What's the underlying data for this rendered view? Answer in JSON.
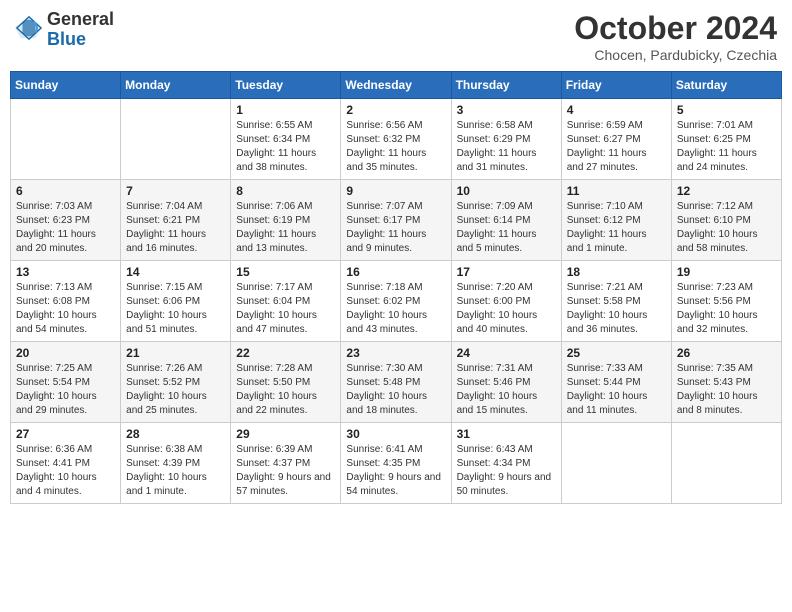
{
  "header": {
    "logo_general": "General",
    "logo_blue": "Blue",
    "month_title": "October 2024",
    "location": "Chocen, Pardubicky, Czechia"
  },
  "weekdays": [
    "Sunday",
    "Monday",
    "Tuesday",
    "Wednesday",
    "Thursday",
    "Friday",
    "Saturday"
  ],
  "weeks": [
    [
      {
        "day": null
      },
      {
        "day": null
      },
      {
        "day": "1",
        "sunrise": "Sunrise: 6:55 AM",
        "sunset": "Sunset: 6:34 PM",
        "daylight": "Daylight: 11 hours and 38 minutes."
      },
      {
        "day": "2",
        "sunrise": "Sunrise: 6:56 AM",
        "sunset": "Sunset: 6:32 PM",
        "daylight": "Daylight: 11 hours and 35 minutes."
      },
      {
        "day": "3",
        "sunrise": "Sunrise: 6:58 AM",
        "sunset": "Sunset: 6:29 PM",
        "daylight": "Daylight: 11 hours and 31 minutes."
      },
      {
        "day": "4",
        "sunrise": "Sunrise: 6:59 AM",
        "sunset": "Sunset: 6:27 PM",
        "daylight": "Daylight: 11 hours and 27 minutes."
      },
      {
        "day": "5",
        "sunrise": "Sunrise: 7:01 AM",
        "sunset": "Sunset: 6:25 PM",
        "daylight": "Daylight: 11 hours and 24 minutes."
      }
    ],
    [
      {
        "day": "6",
        "sunrise": "Sunrise: 7:03 AM",
        "sunset": "Sunset: 6:23 PM",
        "daylight": "Daylight: 11 hours and 20 minutes."
      },
      {
        "day": "7",
        "sunrise": "Sunrise: 7:04 AM",
        "sunset": "Sunset: 6:21 PM",
        "daylight": "Daylight: 11 hours and 16 minutes."
      },
      {
        "day": "8",
        "sunrise": "Sunrise: 7:06 AM",
        "sunset": "Sunset: 6:19 PM",
        "daylight": "Daylight: 11 hours and 13 minutes."
      },
      {
        "day": "9",
        "sunrise": "Sunrise: 7:07 AM",
        "sunset": "Sunset: 6:17 PM",
        "daylight": "Daylight: 11 hours and 9 minutes."
      },
      {
        "day": "10",
        "sunrise": "Sunrise: 7:09 AM",
        "sunset": "Sunset: 6:14 PM",
        "daylight": "Daylight: 11 hours and 5 minutes."
      },
      {
        "day": "11",
        "sunrise": "Sunrise: 7:10 AM",
        "sunset": "Sunset: 6:12 PM",
        "daylight": "Daylight: 11 hours and 1 minute."
      },
      {
        "day": "12",
        "sunrise": "Sunrise: 7:12 AM",
        "sunset": "Sunset: 6:10 PM",
        "daylight": "Daylight: 10 hours and 58 minutes."
      }
    ],
    [
      {
        "day": "13",
        "sunrise": "Sunrise: 7:13 AM",
        "sunset": "Sunset: 6:08 PM",
        "daylight": "Daylight: 10 hours and 54 minutes."
      },
      {
        "day": "14",
        "sunrise": "Sunrise: 7:15 AM",
        "sunset": "Sunset: 6:06 PM",
        "daylight": "Daylight: 10 hours and 51 minutes."
      },
      {
        "day": "15",
        "sunrise": "Sunrise: 7:17 AM",
        "sunset": "Sunset: 6:04 PM",
        "daylight": "Daylight: 10 hours and 47 minutes."
      },
      {
        "day": "16",
        "sunrise": "Sunrise: 7:18 AM",
        "sunset": "Sunset: 6:02 PM",
        "daylight": "Daylight: 10 hours and 43 minutes."
      },
      {
        "day": "17",
        "sunrise": "Sunrise: 7:20 AM",
        "sunset": "Sunset: 6:00 PM",
        "daylight": "Daylight: 10 hours and 40 minutes."
      },
      {
        "day": "18",
        "sunrise": "Sunrise: 7:21 AM",
        "sunset": "Sunset: 5:58 PM",
        "daylight": "Daylight: 10 hours and 36 minutes."
      },
      {
        "day": "19",
        "sunrise": "Sunrise: 7:23 AM",
        "sunset": "Sunset: 5:56 PM",
        "daylight": "Daylight: 10 hours and 32 minutes."
      }
    ],
    [
      {
        "day": "20",
        "sunrise": "Sunrise: 7:25 AM",
        "sunset": "Sunset: 5:54 PM",
        "daylight": "Daylight: 10 hours and 29 minutes."
      },
      {
        "day": "21",
        "sunrise": "Sunrise: 7:26 AM",
        "sunset": "Sunset: 5:52 PM",
        "daylight": "Daylight: 10 hours and 25 minutes."
      },
      {
        "day": "22",
        "sunrise": "Sunrise: 7:28 AM",
        "sunset": "Sunset: 5:50 PM",
        "daylight": "Daylight: 10 hours and 22 minutes."
      },
      {
        "day": "23",
        "sunrise": "Sunrise: 7:30 AM",
        "sunset": "Sunset: 5:48 PM",
        "daylight": "Daylight: 10 hours and 18 minutes."
      },
      {
        "day": "24",
        "sunrise": "Sunrise: 7:31 AM",
        "sunset": "Sunset: 5:46 PM",
        "daylight": "Daylight: 10 hours and 15 minutes."
      },
      {
        "day": "25",
        "sunrise": "Sunrise: 7:33 AM",
        "sunset": "Sunset: 5:44 PM",
        "daylight": "Daylight: 10 hours and 11 minutes."
      },
      {
        "day": "26",
        "sunrise": "Sunrise: 7:35 AM",
        "sunset": "Sunset: 5:43 PM",
        "daylight": "Daylight: 10 hours and 8 minutes."
      }
    ],
    [
      {
        "day": "27",
        "sunrise": "Sunrise: 6:36 AM",
        "sunset": "Sunset: 4:41 PM",
        "daylight": "Daylight: 10 hours and 4 minutes."
      },
      {
        "day": "28",
        "sunrise": "Sunrise: 6:38 AM",
        "sunset": "Sunset: 4:39 PM",
        "daylight": "Daylight: 10 hours and 1 minute."
      },
      {
        "day": "29",
        "sunrise": "Sunrise: 6:39 AM",
        "sunset": "Sunset: 4:37 PM",
        "daylight": "Daylight: 9 hours and 57 minutes."
      },
      {
        "day": "30",
        "sunrise": "Sunrise: 6:41 AM",
        "sunset": "Sunset: 4:35 PM",
        "daylight": "Daylight: 9 hours and 54 minutes."
      },
      {
        "day": "31",
        "sunrise": "Sunrise: 6:43 AM",
        "sunset": "Sunset: 4:34 PM",
        "daylight": "Daylight: 9 hours and 50 minutes."
      },
      {
        "day": null
      },
      {
        "day": null
      }
    ]
  ]
}
